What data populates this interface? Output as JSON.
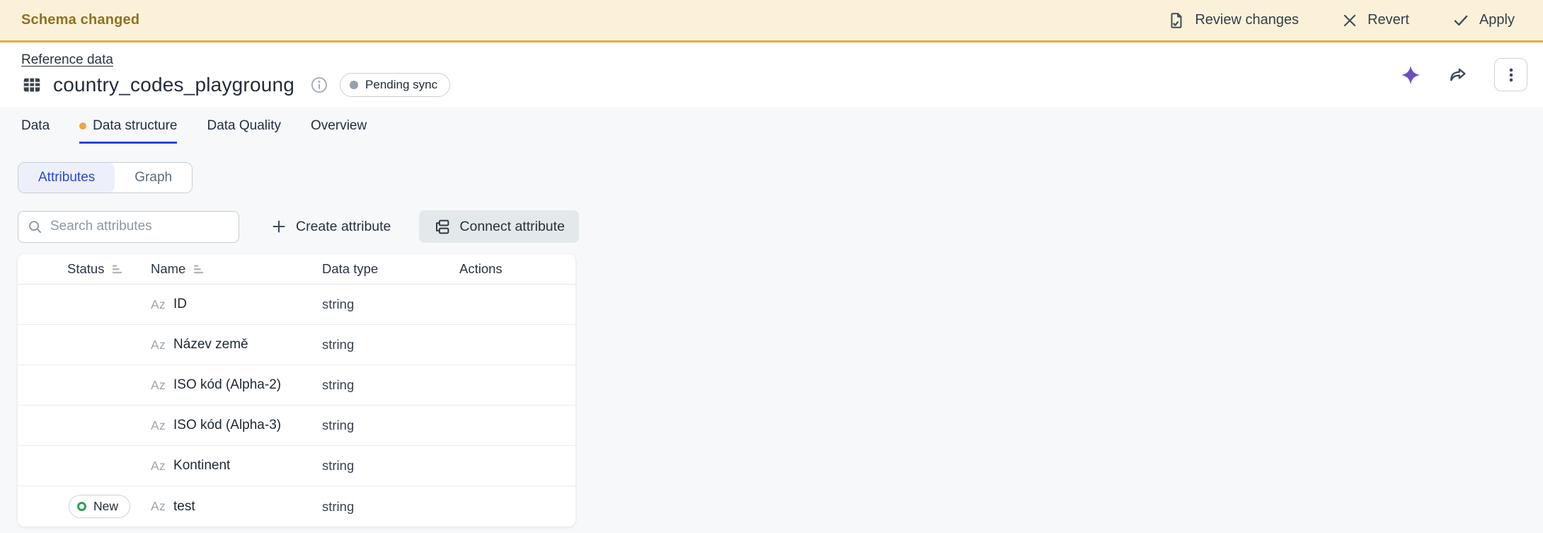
{
  "banner": {
    "message": "Schema changed",
    "actions": [
      {
        "label": "Review changes",
        "icon": "review-changes-icon"
      },
      {
        "label": "Revert",
        "icon": "x-icon"
      },
      {
        "label": "Apply",
        "icon": "check-icon"
      }
    ]
  },
  "header": {
    "breadcrumb": "Reference data",
    "title": "country_codes_playgroung",
    "status_badge": "Pending sync",
    "icons": [
      "ai-sparkle-icon",
      "share-icon",
      "kebab-menu-icon"
    ]
  },
  "tabs": [
    {
      "label": "Data",
      "active": false
    },
    {
      "label": "Data structure",
      "active": true,
      "has_change_dot": true
    },
    {
      "label": "Data Quality",
      "active": false
    },
    {
      "label": "Overview",
      "active": false
    }
  ],
  "view_toggle": {
    "options": [
      "Attributes",
      "Graph"
    ],
    "selected": "Attributes"
  },
  "toolbar": {
    "search_placeholder": "Search attributes",
    "search_value": "",
    "create_label": "Create attribute",
    "connect_label": "Connect attribute"
  },
  "table": {
    "columns": [
      "Status",
      "Name",
      "Data type",
      "Actions"
    ],
    "sortable_columns": [
      "Status",
      "Name"
    ],
    "rows": [
      {
        "status": "",
        "name": "ID",
        "type": "string"
      },
      {
        "status": "",
        "name": "Název země",
        "type": "string"
      },
      {
        "status": "",
        "name": "ISO kód (Alpha-2)",
        "type": "string"
      },
      {
        "status": "",
        "name": "ISO kód (Alpha-3)",
        "type": "string"
      },
      {
        "status": "",
        "name": "Kontinent",
        "type": "string"
      },
      {
        "status": "New",
        "name": "test",
        "type": "string"
      }
    ]
  },
  "colors": {
    "accent_blue": "#2B46D9",
    "banner_bg": "#FBF1D9",
    "banner_border": "#EBA93F",
    "banner_text": "#8E7220",
    "change_dot_orange": "#F0A73E",
    "new_badge_green": "#2F9E54",
    "ai_purple": "#6B4EC2",
    "pending_dot_gray": "#97A1AB",
    "page_bg": "#F6F8FA"
  }
}
